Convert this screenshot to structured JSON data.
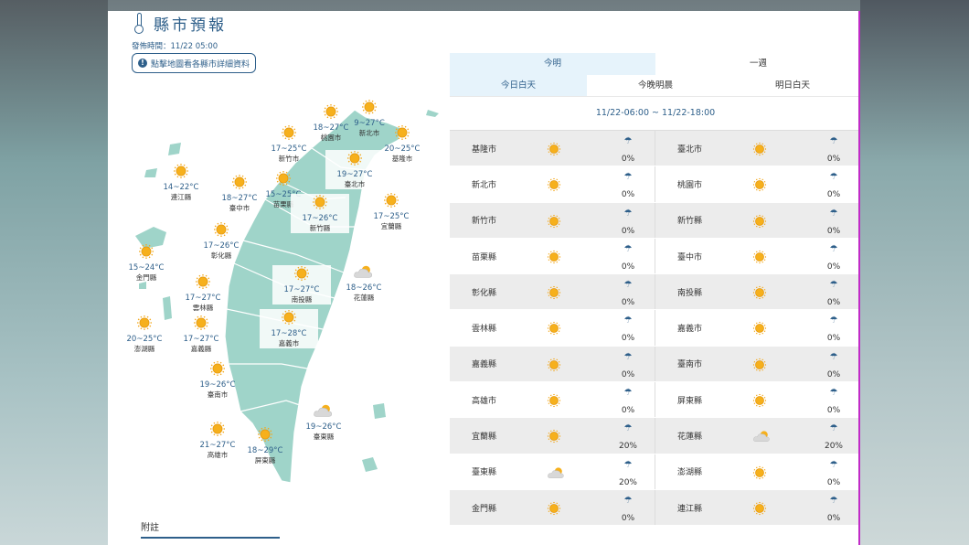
{
  "header": {
    "title": "縣市預報",
    "updated": "發佈時間：11/22 05:00",
    "hint": "點擊地圖看各縣市詳細資料",
    "footnote": "附註"
  },
  "map_cities": [
    {
      "temp": "18~27°C",
      "name": "桃園市",
      "wx": "sunny"
    },
    {
      "temp": "9~27°C",
      "name": "新北市",
      "wx": "sunny"
    },
    {
      "temp": "17~25°C",
      "name": "新竹市",
      "wx": "sunny"
    },
    {
      "temp": "20~25°C",
      "name": "基隆市",
      "wx": "sunny"
    },
    {
      "temp": "19~27°C",
      "name": "臺北市",
      "wx": "sunny"
    },
    {
      "temp": "14~22°C",
      "name": "連江縣",
      "wx": "sunny"
    },
    {
      "temp": "18~27°C",
      "name": "臺中市",
      "wx": "sunny"
    },
    {
      "temp": "15~25°C",
      "name": "苗栗縣",
      "wx": "sunny"
    },
    {
      "temp": "17~26°C",
      "name": "新竹縣",
      "wx": "sunny"
    },
    {
      "temp": "17~25°C",
      "name": "宜蘭縣",
      "wx": "sunny"
    },
    {
      "temp": "17~26°C",
      "name": "彰化縣",
      "wx": "sunny"
    },
    {
      "temp": "15~24°C",
      "name": "金門縣",
      "wx": "sunny"
    },
    {
      "temp": "17~27°C",
      "name": "南投縣",
      "wx": "sunny"
    },
    {
      "temp": "18~26°C",
      "name": "花蓮縣",
      "wx": "cloudy"
    },
    {
      "temp": "17~27°C",
      "name": "雲林縣",
      "wx": "sunny"
    },
    {
      "temp": "20~25°C",
      "name": "澎湖縣",
      "wx": "sunny"
    },
    {
      "temp": "17~28°C",
      "name": "嘉義市",
      "wx": "sunny"
    },
    {
      "temp": "17~27°C",
      "name": "嘉義縣",
      "wx": "sunny"
    },
    {
      "temp": "19~26°C",
      "name": "臺南市",
      "wx": "sunny"
    },
    {
      "temp": "19~26°C",
      "name": "臺東縣",
      "wx": "cloudy"
    },
    {
      "temp": "21~27°C",
      "name": "高雄市",
      "wx": "sunny"
    },
    {
      "temp": "18~29°C",
      "name": "屏東縣",
      "wx": "sunny"
    }
  ],
  "tabs": {
    "main": [
      "今明",
      "一週"
    ],
    "sub": [
      "今日白天",
      "今晚明晨",
      "明日白天"
    ],
    "range": "11/22-06:00 ~ 11/22-18:00"
  },
  "table_rows": [
    [
      {
        "name": "基隆市",
        "wx": "sunny",
        "rain": "0%"
      },
      {
        "name": "臺北市",
        "wx": "sunny",
        "rain": "0%"
      }
    ],
    [
      {
        "name": "新北市",
        "wx": "sunny",
        "rain": "0%"
      },
      {
        "name": "桃園市",
        "wx": "sunny",
        "rain": "0%"
      }
    ],
    [
      {
        "name": "新竹市",
        "wx": "sunny",
        "rain": "0%"
      },
      {
        "name": "新竹縣",
        "wx": "sunny",
        "rain": "0%"
      }
    ],
    [
      {
        "name": "苗栗縣",
        "wx": "sunny",
        "rain": "0%"
      },
      {
        "name": "臺中市",
        "wx": "sunny",
        "rain": "0%"
      }
    ],
    [
      {
        "name": "彰化縣",
        "wx": "sunny",
        "rain": "0%"
      },
      {
        "name": "南投縣",
        "wx": "sunny",
        "rain": "0%"
      }
    ],
    [
      {
        "name": "雲林縣",
        "wx": "sunny",
        "rain": "0%"
      },
      {
        "name": "嘉義市",
        "wx": "sunny",
        "rain": "0%"
      }
    ],
    [
      {
        "name": "嘉義縣",
        "wx": "sunny",
        "rain": "0%"
      },
      {
        "name": "臺南市",
        "wx": "sunny",
        "rain": "0%"
      }
    ],
    [
      {
        "name": "高雄市",
        "wx": "sunny",
        "rain": "0%"
      },
      {
        "name": "屏東縣",
        "wx": "sunny",
        "rain": "0%"
      }
    ],
    [
      {
        "name": "宜蘭縣",
        "wx": "sunny",
        "rain": "20%"
      },
      {
        "name": "花蓮縣",
        "wx": "cloudy",
        "rain": "20%"
      }
    ],
    [
      {
        "name": "臺東縣",
        "wx": "cloudy",
        "rain": "20%"
      },
      {
        "name": "澎湖縣",
        "wx": "sunny",
        "rain": "0%"
      }
    ],
    [
      {
        "name": "金門縣",
        "wx": "sunny",
        "rain": "0%"
      },
      {
        "name": "連江縣",
        "wx": "sunny",
        "rain": "0%"
      }
    ]
  ],
  "icons": {
    "umbrella": "umbrella-icon",
    "sunny": "sunny-icon",
    "cloudy": "cloudy-icon",
    "info": "info-icon",
    "thermometer": "thermometer-icon"
  },
  "colors": {
    "accent": "#2e5f8a",
    "map_fill": "#9fd4c9",
    "tab_active": "#e6f3fb",
    "row_alt": "#ececec",
    "sun": "#f6b01c"
  }
}
